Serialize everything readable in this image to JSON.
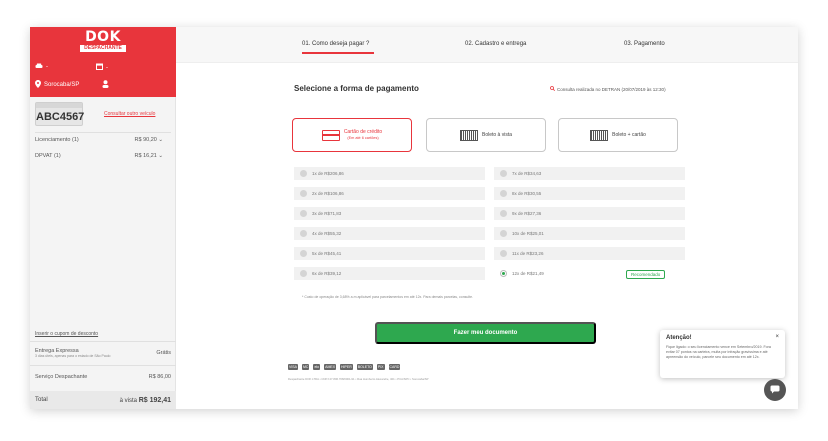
{
  "brand": {
    "logo_text": "DOK",
    "logo_sub": "DESPACHANTE",
    "accent": "#e8353c",
    "green": "#2ea84f"
  },
  "sidebar": {
    "vehicle_label": "-",
    "calendar_label": "-",
    "location": "Sorocaba/SP",
    "plate": "ABC4567",
    "consult_link": "Consultar outro veículo",
    "fees": [
      {
        "label": "Licenciamento (1)",
        "value": "R$ 90,20"
      },
      {
        "label": "DPVAT (1)",
        "value": "R$ 16,21"
      }
    ],
    "coupon_link": "Inserir o cupom de desconto",
    "delivery_title": "Entrega Expressa",
    "delivery_sub": "3 dias úteis, apenas para o estado de São Paulo",
    "delivery_value": "Grátis",
    "service_label": "Serviço Despachante",
    "service_value": "R$ 86,00",
    "total_label": "Total",
    "total_prefix": "à vista",
    "total_value": "R$ 192,41"
  },
  "steps": [
    {
      "label": "01. Como deseja pagar ?"
    },
    {
      "label": "02. Cadastro e entrega"
    },
    {
      "label": "03. Pagamento"
    }
  ],
  "main": {
    "title": "Selecione a forma de pagamento",
    "detran_note": "Consulta realizada no DETRAN (20/07/2019 às 12:30)",
    "pay_options": [
      {
        "label": "Cartão de crédito",
        "sub": "(Em até 6 cartões)"
      },
      {
        "label": "Boleto à vista",
        "sub": ""
      },
      {
        "label": "Boleto + cartão",
        "sub": ""
      }
    ],
    "installments_left": [
      "1x de R$206,86",
      "2x de R$106,86",
      "3x de R$71,83",
      "4x de R$55,32",
      "5x de R$45,41",
      "6x de R$39,12"
    ],
    "installments_right": [
      "7x de R$34,63",
      "8x de R$30,55",
      "9x de R$27,36",
      "10x de R$25,01",
      "11x de R$23,26",
      "12x de R$21,49"
    ],
    "recommended": "Recomendado",
    "footnote": "* Custo de operação de 3,68% a.m aplicável para parcelamentos em até 12x. Para demais parcelas, consulte.",
    "cta": "Fazer meu documento",
    "pay_logos": [
      "VISA",
      "MC",
      "elo",
      "AMEX",
      "HIPER",
      "BOLETO",
      "PIX",
      "CARD"
    ],
    "legal": "Despachante DOK LTDA • CNPJ 27.806.708/0001-91 • Rua Humberto Alexandre, 401 • PCA/SPC • Sorocaba/SP"
  },
  "toast": {
    "title": "Atenção!",
    "close": "×",
    "body": "Fique ligado: o seu licenciamento vence em Setembro/2019. Fora evitar 07 pontos na carteira, multa por infração gravíssima e até apreensão do veículo, parcele seu documento em até 12x."
  }
}
